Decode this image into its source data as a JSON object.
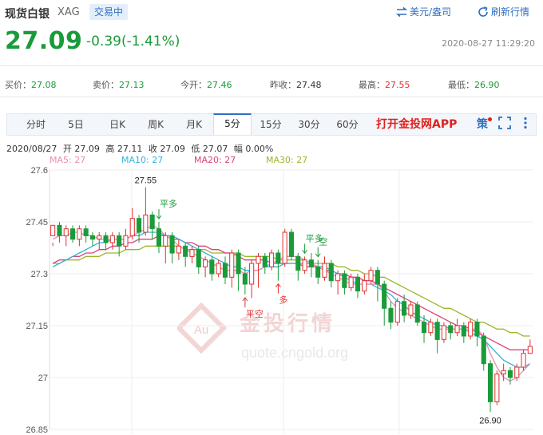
{
  "header": {
    "name": "现货白银",
    "code": "XAG",
    "status": "交易中",
    "unit_link": "美元/盎司",
    "refresh_link": "刷新行情"
  },
  "price": {
    "last": "27.09",
    "change": "-0.39(-1.41%)",
    "timestamp": "2020-08-27 11:29:20"
  },
  "quotes": [
    {
      "label": "买价：",
      "value": "27.08"
    },
    {
      "label": "卖价：",
      "value": "27.13"
    },
    {
      "label": "今开：",
      "value": "27.46"
    },
    {
      "label": "昨收：",
      "value": "27.48"
    },
    {
      "label": "最高：",
      "value": "27.55"
    },
    {
      "label": "最低：",
      "value": "26.90"
    }
  ],
  "tabs": [
    {
      "label": "分时"
    },
    {
      "label": "5日"
    },
    {
      "label": "日K"
    },
    {
      "label": "周K"
    },
    {
      "label": "月K"
    },
    {
      "label": "5分",
      "active": true
    },
    {
      "label": "15分"
    },
    {
      "label": "30分"
    },
    {
      "label": "60分"
    }
  ],
  "toolbar": {
    "app_link": "打开金投网APP",
    "strategy_label": "策",
    "icons": [
      "strategy-icon",
      "fullscreen-icon",
      "more-icon"
    ]
  },
  "ohlc": {
    "date": "2020/08/27",
    "open": "开 27.09",
    "high": "高 27.11",
    "close": "收 27.09",
    "low": "低 27.07",
    "amp": "幅 0.00%"
  },
  "ma": [
    {
      "label": "MA5: 27",
      "color": "#e88fae"
    },
    {
      "label": "MA10: 27",
      "color": "#33b4d8"
    },
    {
      "label": "MA20: 27",
      "color": "#d8447a"
    },
    {
      "label": "MA30: 27",
      "color": "#9bb82a"
    }
  ],
  "watermark": {
    "brand": "金投行情",
    "url": "quote.cngold.org",
    "logo": "Au"
  },
  "colors": {
    "up": "#e03030",
    "down": "#1a9b3a",
    "accent": "#2f6fc0"
  },
  "chart_data": {
    "type": "candlestick",
    "ylim": [
      26.85,
      27.6
    ],
    "yticks": [
      "27.6",
      "27.45",
      "27.3",
      "27.15",
      "27",
      "26.85"
    ],
    "high_label": "27.55",
    "low_label": "26.90",
    "annotations": [
      {
        "text": "平多",
        "color": "#1a9b3a",
        "bar": 16
      },
      {
        "text": "平空",
        "color": "#e03030",
        "bar": 29
      },
      {
        "text": "多",
        "color": "#e03030",
        "bar": 34
      },
      {
        "text": "平多",
        "color": "#1a9b3a",
        "bar": 38
      },
      {
        "text": "空",
        "color": "#1a9b3a",
        "bar": 40
      }
    ],
    "candles": [
      [
        27.41,
        27.44,
        27.39,
        27.38
      ],
      [
        27.44,
        27.41,
        27.45,
        27.39
      ],
      [
        27.41,
        27.43,
        27.44,
        27.38
      ],
      [
        27.43,
        27.4,
        27.44,
        27.39
      ],
      [
        27.4,
        27.43,
        27.44,
        27.38
      ],
      [
        27.43,
        27.41,
        27.44,
        27.39
      ],
      [
        27.41,
        27.4,
        27.42,
        27.38
      ],
      [
        27.4,
        27.41,
        27.42,
        27.37
      ],
      [
        27.41,
        27.39,
        27.42,
        27.37
      ],
      [
        27.39,
        27.41,
        27.42,
        27.37
      ],
      [
        27.41,
        27.38,
        27.42,
        27.35
      ],
      [
        27.38,
        27.41,
        27.43,
        27.37
      ],
      [
        27.41,
        27.46,
        27.49,
        27.4
      ],
      [
        27.46,
        27.42,
        27.47,
        27.39
      ],
      [
        27.42,
        27.47,
        27.55,
        27.41
      ],
      [
        27.47,
        27.43,
        27.48,
        27.4
      ],
      [
        27.43,
        27.38,
        27.45,
        27.36
      ],
      [
        27.38,
        27.41,
        27.42,
        27.33
      ],
      [
        27.41,
        27.36,
        27.42,
        27.33
      ],
      [
        27.36,
        27.38,
        27.4,
        27.34
      ],
      [
        27.38,
        27.35,
        27.39,
        27.32
      ],
      [
        27.35,
        27.37,
        27.38,
        27.33
      ],
      [
        27.37,
        27.32,
        27.38,
        27.3
      ],
      [
        27.32,
        27.34,
        27.35,
        27.29
      ],
      [
        27.34,
        27.3,
        27.35,
        27.28
      ],
      [
        27.3,
        27.33,
        27.34,
        27.29
      ],
      [
        27.33,
        27.29,
        27.35,
        27.27
      ],
      [
        27.29,
        27.36,
        27.37,
        27.26
      ],
      [
        27.36,
        27.3,
        27.37,
        27.25
      ],
      [
        27.3,
        27.27,
        27.32,
        27.24
      ],
      [
        27.27,
        27.33,
        27.34,
        27.23
      ],
      [
        27.33,
        27.35,
        27.36,
        27.26
      ],
      [
        27.35,
        27.32,
        27.36,
        27.3
      ],
      [
        27.32,
        27.36,
        27.37,
        27.31
      ],
      [
        27.36,
        27.33,
        27.37,
        27.28
      ],
      [
        27.33,
        27.42,
        27.43,
        27.32
      ],
      [
        27.42,
        27.35,
        27.43,
        27.34
      ],
      [
        27.35,
        27.31,
        27.36,
        27.28
      ],
      [
        27.31,
        27.34,
        27.35,
        27.3
      ],
      [
        27.34,
        27.32,
        27.36,
        27.29
      ],
      [
        27.32,
        27.29,
        27.34,
        27.27
      ],
      [
        27.29,
        27.33,
        27.35,
        27.28
      ],
      [
        27.33,
        27.28,
        27.34,
        27.26
      ],
      [
        27.28,
        27.3,
        27.31,
        27.24
      ],
      [
        27.3,
        27.26,
        27.31,
        27.24
      ],
      [
        27.26,
        27.29,
        27.3,
        27.25
      ],
      [
        27.29,
        27.25,
        27.3,
        27.23
      ],
      [
        27.25,
        27.28,
        27.3,
        27.24
      ],
      [
        27.28,
        27.31,
        27.32,
        27.27
      ],
      [
        27.31,
        27.27,
        27.32,
        27.22
      ],
      [
        27.27,
        27.2,
        27.28,
        27.15
      ],
      [
        27.2,
        27.16,
        27.22,
        27.14
      ],
      [
        27.16,
        27.22,
        27.23,
        27.15
      ],
      [
        27.22,
        27.18,
        27.24,
        27.16
      ],
      [
        27.18,
        27.21,
        27.22,
        27.17
      ],
      [
        27.21,
        27.16,
        27.22,
        27.15
      ],
      [
        27.16,
        27.13,
        27.18,
        27.1
      ],
      [
        27.13,
        27.16,
        27.17,
        27.12
      ],
      [
        27.16,
        27.11,
        27.17,
        27.07
      ],
      [
        27.11,
        27.15,
        27.16,
        27.1
      ],
      [
        27.15,
        27.13,
        27.16,
        27.11
      ],
      [
        27.13,
        27.15,
        27.17,
        27.12
      ],
      [
        27.15,
        27.12,
        27.16,
        27.1
      ],
      [
        27.12,
        27.16,
        27.17,
        27.11
      ],
      [
        27.16,
        27.12,
        27.17,
        27.09
      ],
      [
        27.12,
        27.04,
        27.13,
        27.02
      ],
      [
        27.04,
        26.93,
        27.05,
        26.9
      ],
      [
        26.93,
        27.01,
        27.02,
        26.92
      ],
      [
        27.01,
        27.02,
        27.04,
        26.99
      ],
      [
        27.02,
        27.0,
        27.03,
        26.98
      ],
      [
        27.0,
        27.03,
        27.04,
        26.99
      ],
      [
        27.03,
        27.07,
        27.08,
        27.02
      ],
      [
        27.07,
        27.09,
        27.11,
        27.07
      ]
    ],
    "ma5": [
      27.4,
      27.41,
      27.41,
      27.42,
      27.42,
      27.41,
      27.41,
      27.4,
      27.4,
      27.4,
      27.4,
      27.4,
      27.41,
      27.42,
      27.43,
      27.44,
      27.43,
      27.41,
      27.4,
      27.38,
      27.37,
      27.36,
      27.35,
      27.34,
      27.33,
      27.32,
      27.31,
      27.31,
      27.31,
      27.3,
      27.31,
      27.31,
      27.32,
      27.33,
      27.34,
      27.35,
      27.35,
      27.35,
      27.34,
      27.33,
      27.32,
      27.31,
      27.3,
      27.29,
      27.28,
      27.27,
      27.27,
      27.27,
      27.27,
      27.27,
      27.25,
      27.22,
      27.2,
      27.19,
      27.18,
      27.17,
      27.16,
      27.15,
      27.14,
      27.14,
      27.14,
      27.14,
      27.14,
      27.14,
      27.14,
      27.12,
      27.07,
      27.03,
      27.0,
      26.99,
      27.0,
      27.02,
      27.04
    ],
    "ma10": [
      27.32,
      27.33,
      27.34,
      27.35,
      27.36,
      27.37,
      27.38,
      27.39,
      27.39,
      27.4,
      27.4,
      27.4,
      27.41,
      27.41,
      27.42,
      27.42,
      27.42,
      27.41,
      27.41,
      27.4,
      27.39,
      27.38,
      27.37,
      27.36,
      27.35,
      27.34,
      27.33,
      27.32,
      27.32,
      27.31,
      27.31,
      27.31,
      27.32,
      27.32,
      27.32,
      27.33,
      27.33,
      27.33,
      27.33,
      27.33,
      27.32,
      27.32,
      27.31,
      27.3,
      27.29,
      27.28,
      27.27,
      27.27,
      27.27,
      27.26,
      27.25,
      27.24,
      27.22,
      27.21,
      27.19,
      27.18,
      27.17,
      27.16,
      27.15,
      27.15,
      27.14,
      27.14,
      27.14,
      27.13,
      27.12,
      27.11,
      27.09,
      27.07,
      27.05,
      27.04,
      27.03,
      27.03,
      27.04
    ],
    "ma20": [
      27.33,
      27.34,
      27.34,
      27.35,
      27.35,
      27.36,
      27.36,
      27.37,
      27.37,
      27.38,
      27.38,
      27.39,
      27.39,
      27.4,
      27.4,
      27.4,
      27.41,
      27.41,
      27.4,
      27.4,
      27.39,
      27.39,
      27.38,
      27.38,
      27.37,
      27.37,
      27.36,
      27.36,
      27.35,
      27.34,
      27.34,
      27.34,
      27.34,
      27.33,
      27.33,
      27.33,
      27.33,
      27.33,
      27.32,
      27.32,
      27.32,
      27.31,
      27.31,
      27.3,
      27.3,
      27.29,
      27.29,
      27.28,
      27.28,
      27.27,
      27.26,
      27.25,
      27.24,
      27.23,
      27.22,
      27.21,
      27.2,
      27.19,
      27.18,
      27.17,
      27.16,
      27.15,
      27.15,
      27.14,
      27.13,
      27.12,
      27.11,
      27.1,
      27.09,
      27.08,
      27.08,
      27.08,
      27.08
    ],
    "ma30": [
      27.33,
      27.33,
      27.34,
      27.34,
      27.34,
      27.35,
      27.35,
      27.35,
      27.36,
      27.36,
      27.36,
      27.37,
      27.37,
      27.37,
      27.38,
      27.38,
      27.38,
      27.38,
      27.38,
      27.38,
      27.37,
      27.37,
      27.37,
      27.37,
      27.36,
      27.36,
      27.36,
      27.36,
      27.36,
      27.35,
      27.35,
      27.35,
      27.35,
      27.35,
      27.34,
      27.34,
      27.34,
      27.34,
      27.34,
      27.33,
      27.33,
      27.33,
      27.33,
      27.32,
      27.32,
      27.31,
      27.31,
      27.3,
      27.3,
      27.29,
      27.29,
      27.28,
      27.27,
      27.26,
      27.25,
      27.24,
      27.23,
      27.22,
      27.21,
      27.2,
      27.2,
      27.19,
      27.18,
      27.17,
      27.16,
      27.16,
      27.15,
      27.14,
      27.14,
      27.13,
      27.13,
      27.12,
      27.12
    ]
  }
}
